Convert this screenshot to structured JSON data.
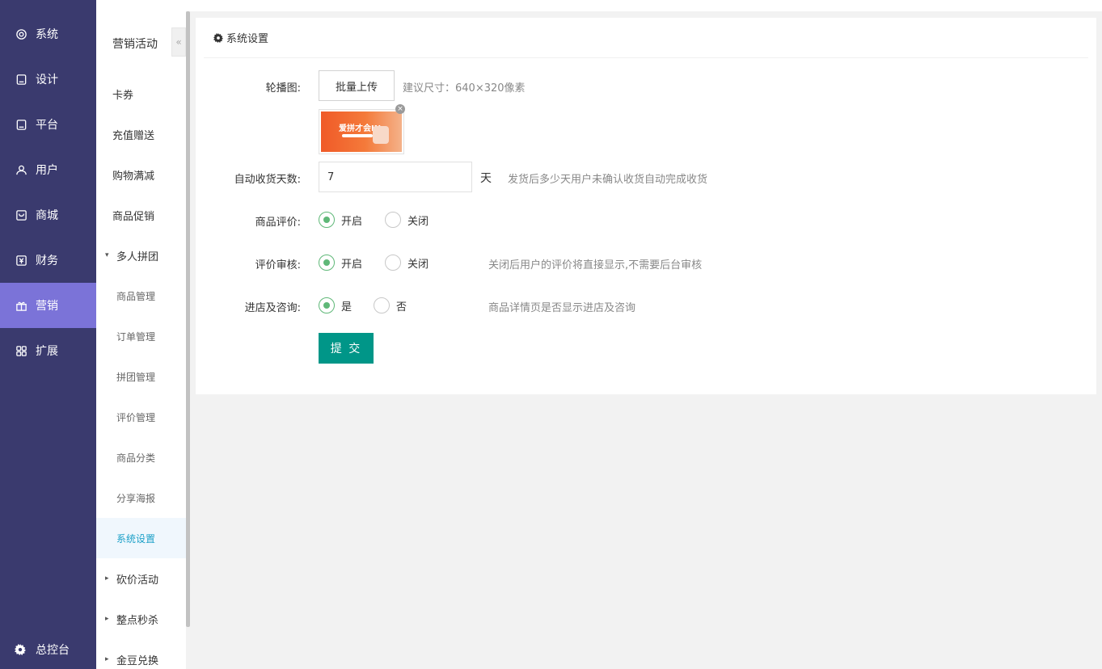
{
  "nav": {
    "items": [
      {
        "label": "系统",
        "icon": "gear-icon"
      },
      {
        "label": "设计",
        "icon": "monitor-icon"
      },
      {
        "label": "平台",
        "icon": "monitor-icon"
      },
      {
        "label": "用户",
        "icon": "user-icon"
      },
      {
        "label": "商城",
        "icon": "shop-icon"
      },
      {
        "label": "财务",
        "icon": "yen-icon"
      },
      {
        "label": "营销",
        "icon": "gift-icon"
      },
      {
        "label": "扩展",
        "icon": "grid-icon"
      }
    ],
    "active_index": 6,
    "bottom_label": "总控台",
    "active_color": "#7b73d8",
    "bg_color": "#3a3a6e"
  },
  "subnav": {
    "title": "营销活动",
    "collapse_glyph": "«",
    "items": [
      {
        "label": "卡券"
      },
      {
        "label": "充值赠送"
      },
      {
        "label": "购物满减"
      },
      {
        "label": "商品促销"
      },
      {
        "label": "多人拼团",
        "caret": "▾"
      },
      {
        "label": "商品管理"
      },
      {
        "label": "订单管理"
      },
      {
        "label": "拼团管理"
      },
      {
        "label": "评价管理"
      },
      {
        "label": "商品分类"
      },
      {
        "label": "分享海报"
      },
      {
        "label": "系统设置"
      },
      {
        "label": "砍价活动",
        "caret": "▸"
      },
      {
        "label": "整点秒杀",
        "caret": "▸"
      },
      {
        "label": "金豆兑换",
        "caret": "▸"
      }
    ]
  },
  "panel": {
    "title": "系统设置",
    "carousel": {
      "label": "轮播图:",
      "upload_button": "批量上传",
      "hint": "建议尺寸：640×320像素",
      "thumb_text": "爱拼才会IN",
      "close_glyph": "×"
    },
    "auto_receive": {
      "label": "自动收货天数:",
      "value": "7",
      "unit": "天",
      "hint": "发货后多少天用户未确认收货自动完成收货"
    },
    "review": {
      "label": "商品评价:",
      "options": [
        "开启",
        "关闭"
      ],
      "selected": "开启"
    },
    "review_audit": {
      "label": "评价审核:",
      "options": [
        "开启",
        "关闭"
      ],
      "selected": "开启",
      "hint": "关闭后用户的评价将直接显示,不需要后台审核"
    },
    "consult": {
      "label": "进店及咨询:",
      "options": [
        "是",
        "否"
      ],
      "selected": "是",
      "hint": "商品详情页是否显示进店及咨询"
    },
    "submit_label": "提 交",
    "submit_color": "#009688",
    "radio_color": "#5fb878"
  }
}
